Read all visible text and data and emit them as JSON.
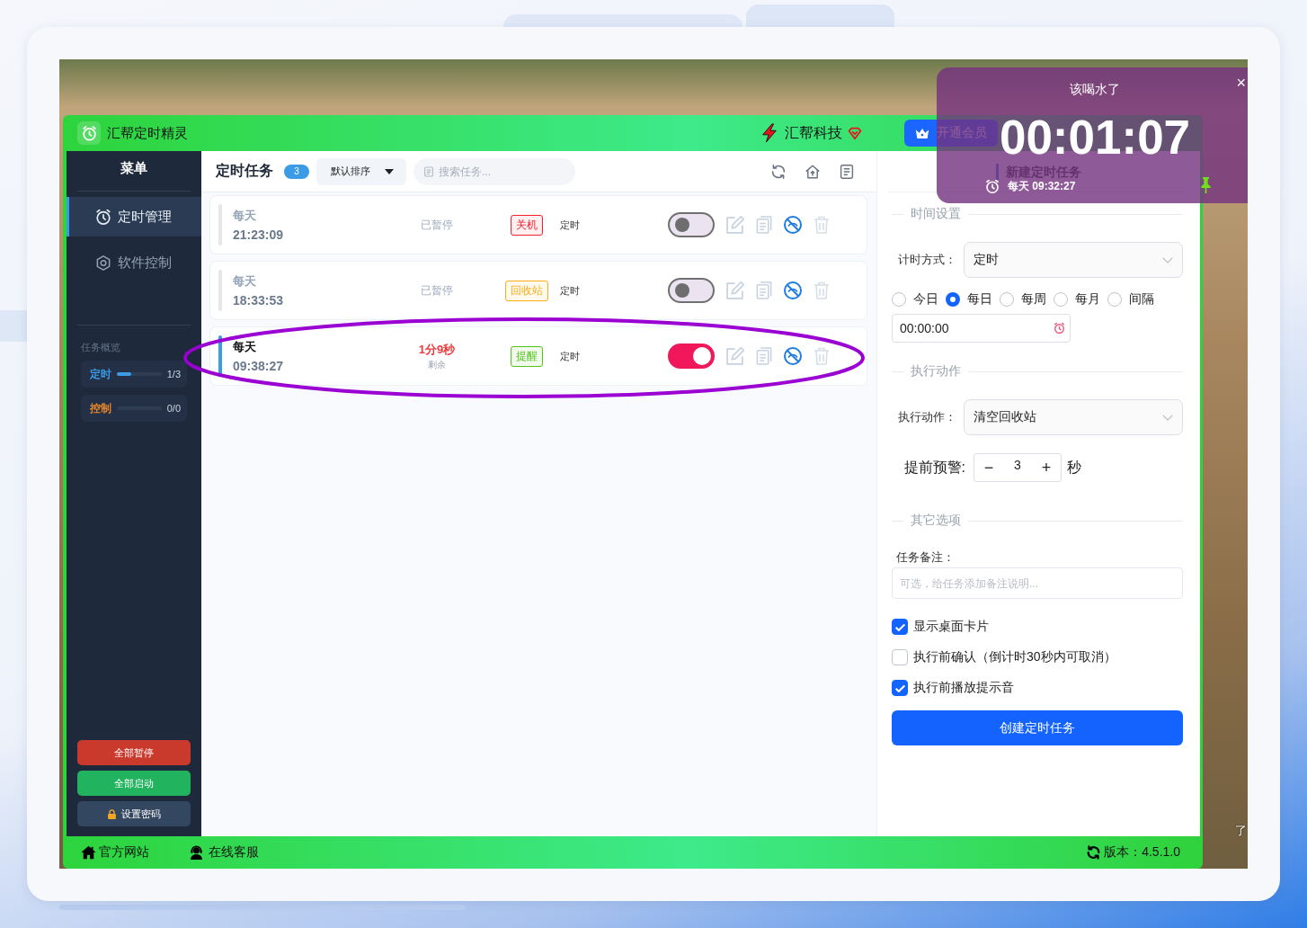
{
  "app": {
    "title": "汇帮定时精灵",
    "brand": "汇帮科技",
    "vip_button": "开通会员"
  },
  "sidebar": {
    "title": "菜单",
    "items": [
      {
        "label": "定时管理",
        "kind": "timer",
        "selected": true
      },
      {
        "label": "软件控制",
        "kind": "control",
        "selected": false
      }
    ],
    "overview": {
      "title": "任务概览",
      "meters": [
        {
          "label": "定时",
          "color": "#3b9be6",
          "level": 0.33,
          "count": "1/3"
        },
        {
          "label": "控制",
          "color": "#e6862a",
          "count": "0/0"
        }
      ]
    },
    "buttons": [
      {
        "label": "全部暂停",
        "kind": "danger"
      },
      {
        "label": "全部启动",
        "kind": "success"
      },
      {
        "label": "设置密码",
        "kind": "lock"
      }
    ]
  },
  "task_list": {
    "title": "定时任务",
    "count": "3",
    "sort": "默认排序",
    "search": {
      "placeholder": "搜索任务..."
    },
    "tasks": [
      {
        "repeat": "每天",
        "time": "21:23:09",
        "status": {
          "kind": "paused",
          "text": "已暂停"
        },
        "action": {
          "label": "关机",
          "color": "#f5222d"
        },
        "type": "定时",
        "on": false,
        "circled": false
      },
      {
        "repeat": "每天",
        "time": "18:33:53",
        "status": {
          "kind": "paused",
          "text": "已暂停"
        },
        "action": {
          "label": "回收站",
          "color": "#faad14"
        },
        "type": "定时",
        "on": false,
        "circled": false
      },
      {
        "repeat": "每天",
        "time": "09:38:27",
        "status": {
          "kind": "countdown",
          "text": "1分9秒",
          "note": "剩余"
        },
        "action": {
          "label": "提醒",
          "color": "#52c41a"
        },
        "type": "定时",
        "on": true,
        "circled": true
      }
    ]
  },
  "form": {
    "title": "新建定时任务",
    "time_section": {
      "heading": "时间设置",
      "mode": {
        "label": "计时方式：",
        "value": "定时"
      },
      "repeat_options": [
        {
          "label": "今日",
          "selected": false
        },
        {
          "label": "每日",
          "selected": true
        },
        {
          "label": "每周",
          "selected": false
        },
        {
          "label": "每月",
          "selected": false
        },
        {
          "label": "间隔",
          "selected": false
        }
      ],
      "time": {
        "value": "00:00:00"
      }
    },
    "action_section": {
      "heading": "执行动作",
      "action": {
        "label": "执行动作：",
        "value": "清空回收站"
      },
      "warning": {
        "label": "提前预警:",
        "minus": "−",
        "value": "3",
        "plus": "+",
        "unit": "秒"
      }
    },
    "other_section": {
      "heading": "其它选项",
      "note": {
        "label": "任务备注：",
        "placeholder": "可选，给任务添加备注说明..."
      },
      "options": [
        {
          "label": "显示桌面卡片",
          "checked": true
        },
        {
          "label": "执行前确认（倒计时30秒内可取消）",
          "checked": false
        },
        {
          "label": "执行前播放提示音",
          "checked": true
        }
      ]
    },
    "submit": "创建定时任务"
  },
  "popup": {
    "title": "该喝水了",
    "close": "×",
    "timer": "00:01:07",
    "schedule": "每天 09:32:27"
  },
  "footer": {
    "links": [
      {
        "label": "官方网站",
        "kind": "website"
      },
      {
        "label": "在线客服",
        "kind": "support"
      }
    ],
    "version": "版本：4.5.1.0"
  },
  "desktop_fragment": "了"
}
